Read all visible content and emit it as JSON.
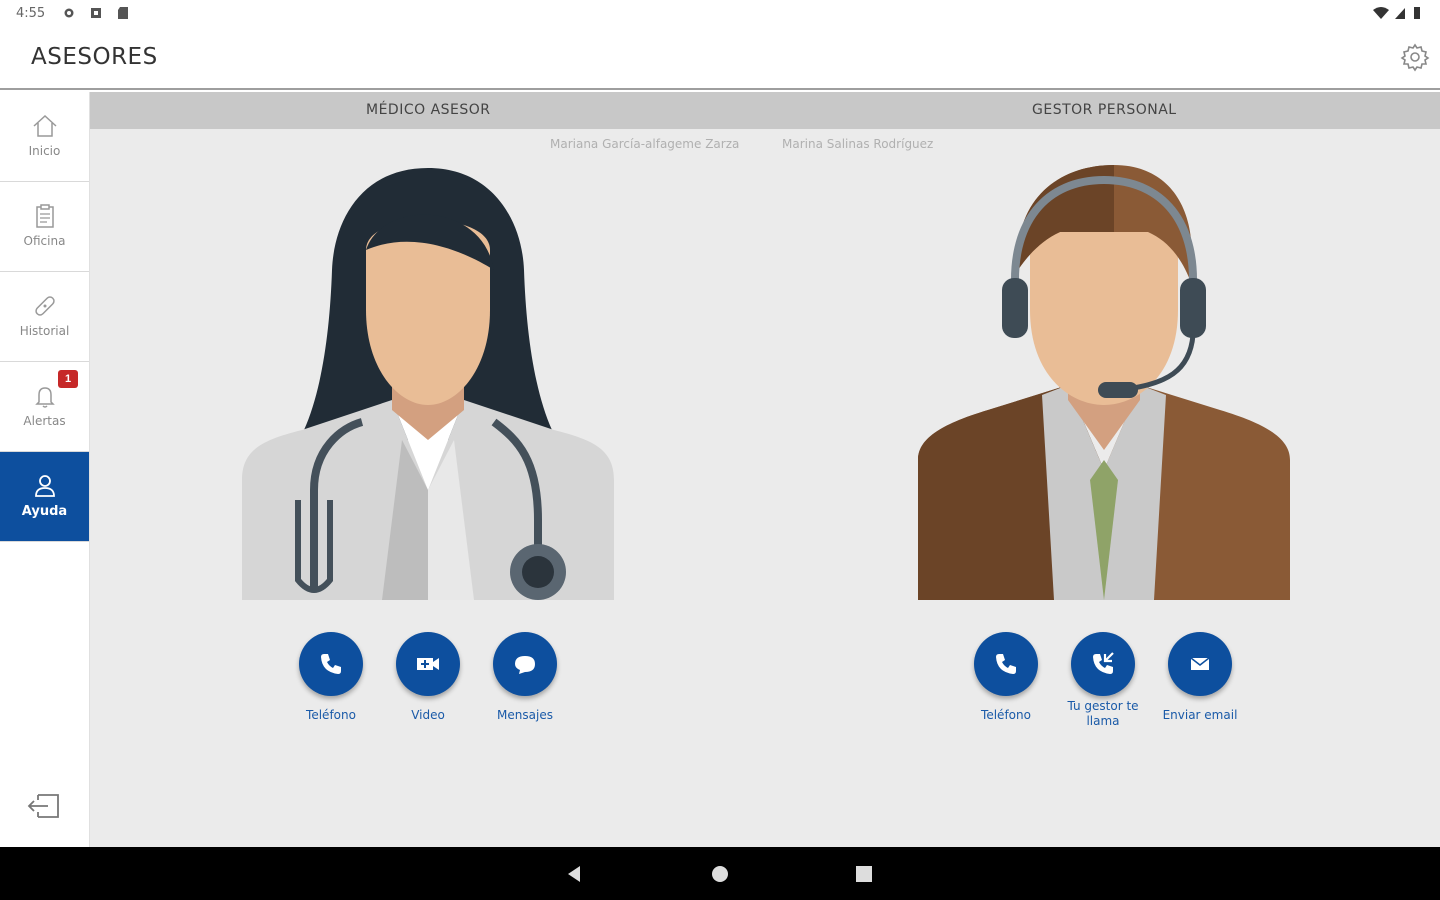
{
  "status_bar": {
    "time": "4:55"
  },
  "app_bar": {
    "title": "ASESORES"
  },
  "sidebar": {
    "items": [
      {
        "label": "Inicio",
        "icon": "home-icon"
      },
      {
        "label": "Oficina",
        "icon": "clipboard-icon"
      },
      {
        "label": "Historial",
        "icon": "bandage-icon"
      },
      {
        "label": "Alertas",
        "icon": "bell-icon",
        "badge": "1"
      },
      {
        "label": "Ayuda",
        "icon": "user-icon",
        "active": true
      }
    ]
  },
  "main": {
    "medico": {
      "header": "MÉDICO ASESOR",
      "name": "Mariana García-alfageme Zarza",
      "actions": [
        {
          "label": "Teléfono",
          "icon": "phone-icon"
        },
        {
          "label": "Video",
          "icon": "video-icon"
        },
        {
          "label": "Mensajes",
          "icon": "chat-icon"
        }
      ]
    },
    "gestor": {
      "header": "GESTOR PERSONAL",
      "name": "Marina Salinas Rodríguez",
      "actions": [
        {
          "label": "Teléfono",
          "icon": "phone-icon"
        },
        {
          "label": "Tu gestor te llama",
          "icon": "phone-callback-icon"
        },
        {
          "label": "Enviar email",
          "icon": "email-icon"
        }
      ]
    }
  },
  "colors": {
    "accent": "#0d4f9e",
    "badge": "#c62828",
    "content_bg": "#ebebeb",
    "header_strip": "#c8c8c8"
  }
}
